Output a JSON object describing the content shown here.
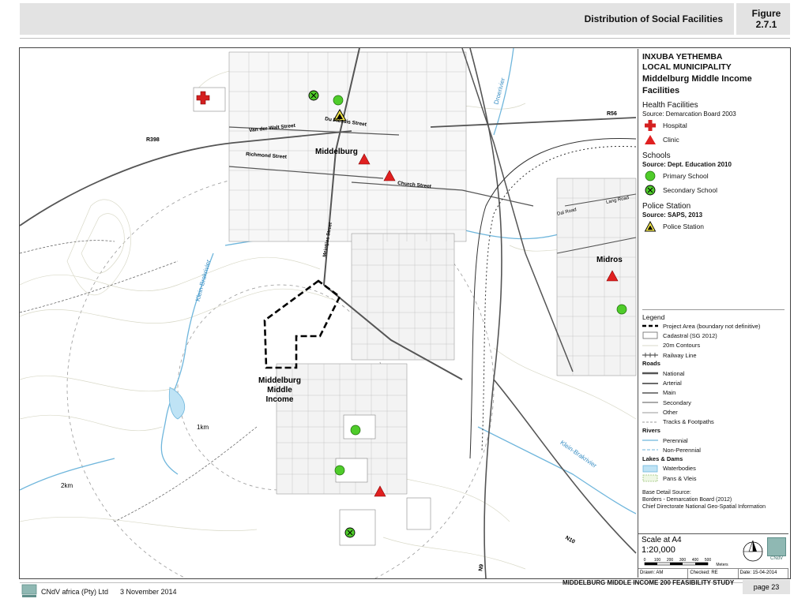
{
  "header": {
    "title": "Distribution of Social Facilities",
    "figure_line1": "Figure",
    "figure_line2": "2.7.1"
  },
  "legend": {
    "title_line1": "INXUBA YETHEMBA",
    "title_line2": "LOCAL MUNICIPALITY",
    "subtitle_line1": "Middelburg Middle Income",
    "subtitle_line2": "Facilities",
    "health_heading": "Health Facilities",
    "health_source": "Source: Demarcation Board 2003",
    "hospital": "Hospital",
    "clinic": "Clinic",
    "schools_heading": "Schools",
    "schools_source": "Source: Dept. Education 2010",
    "primary_school": "Primary School",
    "secondary_school": "Secondary School",
    "police_heading": "Police Station",
    "police_source": "Source: SAPS, 2013",
    "police_station": "Police Station",
    "legend_heading": "Legend",
    "project_area": "Project Area (boundary not definitive)",
    "cadastral": "Cadastral (SG 2012)",
    "contours": "20m Contours",
    "railway": "Railway Line",
    "roads_heading": "Roads",
    "national": "National",
    "arterial": "Arterial",
    "main": "Main",
    "secondary": "Secondary",
    "other": "Other",
    "tracks": "Tracks & Footpaths",
    "rivers_heading": "Rivers",
    "perennial": "Perennial",
    "non_perennial": "Non-Perennial",
    "lakes_heading": "Lakes & Dams",
    "waterbodies": "Waterbodies",
    "pans": "Pans & Vleis",
    "base_line1": "Base Detail Source:",
    "base_line2": "Borders - Demarcation Board (2012)",
    "base_line3": "Chief Directorate National Geo-Spatial Information"
  },
  "scale": {
    "title": "Scale at A4",
    "ratio": "1:20,000",
    "ticks": [
      "0",
      "100",
      "200",
      "300",
      "400",
      "500"
    ],
    "unit": "Meters",
    "drawn": "Drawn: AM",
    "checked": "Checked: RE",
    "date": "Date: 15-04-2014",
    "logo_text": "CNdV"
  },
  "map_labels": {
    "middelburg": "Middelburg",
    "midros": "Midros",
    "project_line1": "Middelburg",
    "project_line2": "Middle",
    "project_line3": "Income",
    "r398": "R398",
    "r56": "R56",
    "n10": "N10",
    "n9": "N9",
    "van_der_walt": "Van der Walt Street",
    "richmond": "Richmond Street",
    "du_plessis": "Du Plessis Street",
    "church": "Church Street",
    "meintjies": "Meintjies Street",
    "lang": "Lang Road",
    "dal": "Dal Road",
    "klein_brakrivier_w": "Klein-Brakrivier",
    "klein_brakrivier_e": "Klein-Brakrivier",
    "droerivier": "Droerivier",
    "km1": "1km",
    "km2": "2km"
  },
  "footer": {
    "company": "CNdV africa (Pty) Ltd",
    "date": "3 November 2014",
    "study": "MIDDELBURG MIDDLE INCOME 200 FEASIBILITY STUDY",
    "page": "page 23"
  },
  "colors": {
    "hospital": "#d42020",
    "clinic": "#e02020",
    "primary_school": "#4fcc2a",
    "secondary_school": "#4fcc2a",
    "police": "#f2e64a",
    "river": "#6fb6dc",
    "water": "#bfe3f5",
    "road": "#555555"
  }
}
